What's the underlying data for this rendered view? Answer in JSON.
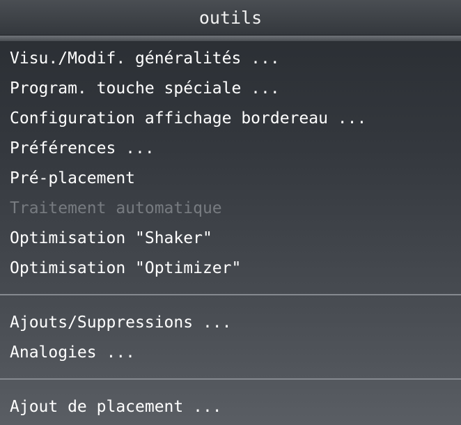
{
  "menu": {
    "title": "outils",
    "items": [
      {
        "label": "Visu./Modif. généralités ...",
        "enabled": true
      },
      {
        "label": "Program. touche spéciale ...",
        "enabled": true
      },
      {
        "label": "Configuration affichage bordereau ...",
        "enabled": true
      },
      {
        "label": "Préférences ...",
        "enabled": true
      },
      {
        "label": "Pré-placement",
        "enabled": true
      },
      {
        "label": "Traitement automatique",
        "enabled": false
      },
      {
        "label": "Optimisation \"Shaker\"",
        "enabled": true
      },
      {
        "label": "Optimisation \"Optimizer\"",
        "enabled": true
      },
      {
        "label": "Ajouts/Suppressions ...",
        "enabled": true
      },
      {
        "label": "Analogies ...",
        "enabled": true
      },
      {
        "label": "Ajout de placement ...",
        "enabled": true
      }
    ]
  }
}
